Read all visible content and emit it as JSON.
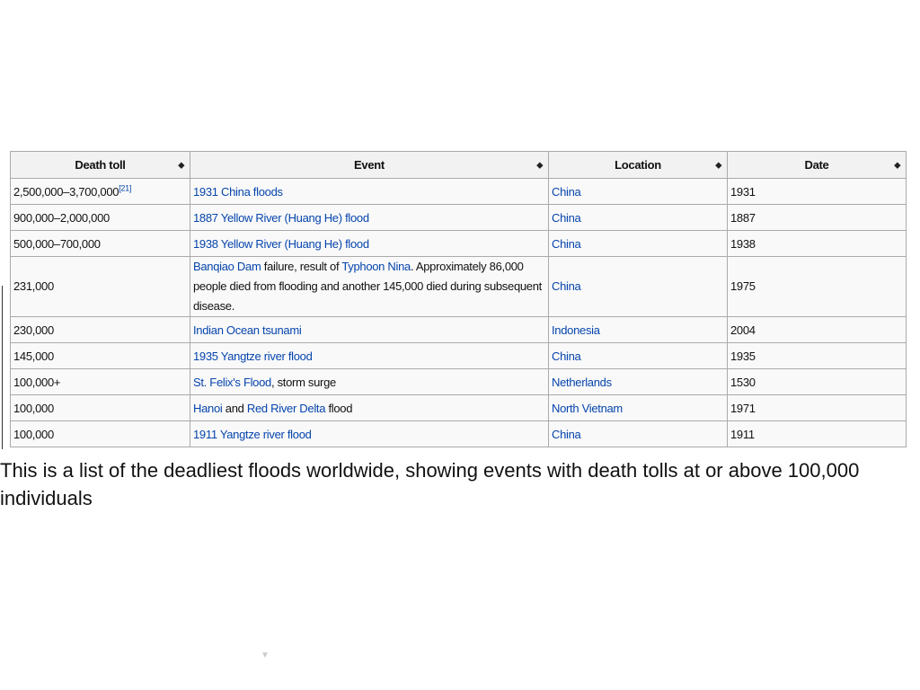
{
  "table": {
    "headers": [
      "Death toll",
      "Event",
      "Location",
      "Date"
    ],
    "rows": [
      {
        "death_toll": "2,500,000–3,700,000",
        "ref": "[21]",
        "event": [
          {
            "text": "1931 China floods",
            "link": true
          }
        ],
        "location": "China",
        "date": "1931"
      },
      {
        "death_toll": "900,000–2,000,000",
        "event": [
          {
            "text": "1887 Yellow River (Huang He) flood",
            "link": true
          }
        ],
        "location": "China",
        "date": "1887"
      },
      {
        "death_toll": "500,000–700,000",
        "event": [
          {
            "text": "1938 Yellow River (Huang He) flood",
            "link": true
          }
        ],
        "location": "China",
        "date": "1938"
      },
      {
        "death_toll": "231,000",
        "event": [
          {
            "text": "Banqiao Dam",
            "link": true
          },
          {
            "text": " failure, result of ",
            "link": false
          },
          {
            "text": "Typhoon Nina",
            "link": true
          },
          {
            "text": ". Approximately 86,000 people died from flooding and another 145,000 died during subsequent disease.",
            "link": false
          }
        ],
        "location": "China",
        "date": "1975",
        "tall": true
      },
      {
        "death_toll": "230,000",
        "event": [
          {
            "text": "Indian Ocean tsunami",
            "link": true
          }
        ],
        "location": "Indonesia",
        "date": "2004"
      },
      {
        "death_toll": "145,000",
        "event": [
          {
            "text": "1935 Yangtze river flood",
            "link": true
          }
        ],
        "location": "China",
        "date": "1935"
      },
      {
        "death_toll": "100,000+",
        "event": [
          {
            "text": "St. Felix's Flood",
            "link": true
          },
          {
            "text": ", storm surge",
            "link": false
          }
        ],
        "location": "Netherlands",
        "date": "1530"
      },
      {
        "death_toll": "100,000",
        "event": [
          {
            "text": "Hanoi",
            "link": true
          },
          {
            "text": " and ",
            "link": false
          },
          {
            "text": "Red River Delta",
            "link": true
          },
          {
            "text": " flood",
            "link": false
          }
        ],
        "location": "North Vietnam",
        "date": "1971"
      },
      {
        "death_toll": "100,000",
        "event": [
          {
            "text": "1911 Yangtze river flood",
            "link": true
          }
        ],
        "location": "China",
        "date": "1911"
      }
    ]
  },
  "caption": "This is a list of the deadliest floods worldwide, showing events with death tolls at or above 100,000 individuals",
  "icons": {
    "sort": "sort-updown-icon"
  },
  "colors": {
    "link": "#0645ad",
    "header_bg": "#f2f2f2",
    "cell_bg": "#f9f9f9",
    "border": "#aaaaaa"
  }
}
